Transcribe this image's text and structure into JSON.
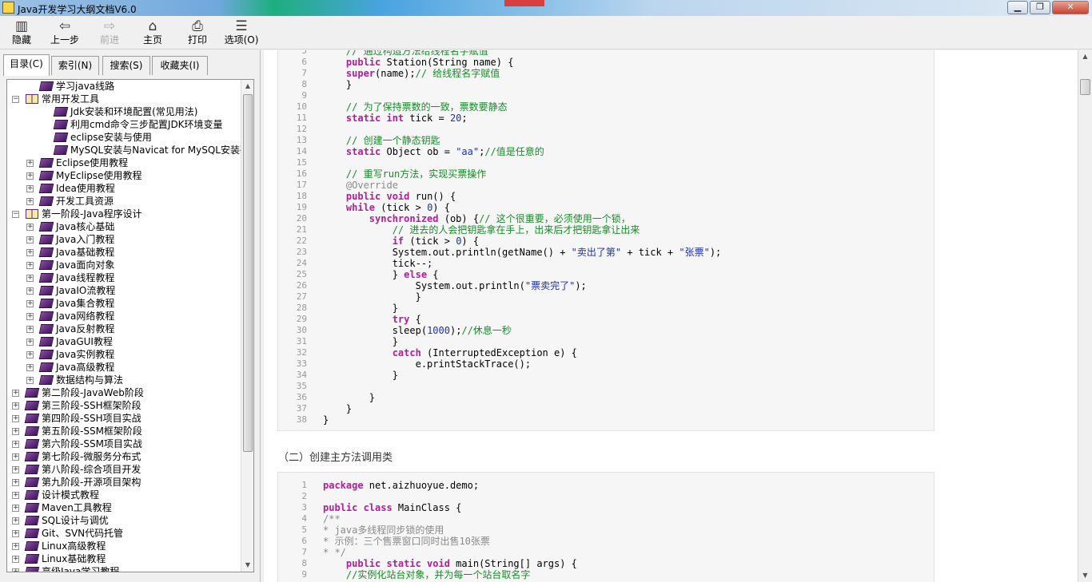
{
  "window": {
    "title": "Java开发学习大纲文档V6.0",
    "buttons": {
      "minimize": "▁",
      "restore": "❐",
      "close": "✕"
    }
  },
  "toolbar": {
    "hide": {
      "label": "隐藏",
      "icon": "hide-icon"
    },
    "back": {
      "label": "上一步",
      "icon": "back-arrow-icon"
    },
    "forward": {
      "label": "前进",
      "icon": "forward-arrow-icon"
    },
    "home": {
      "label": "主页",
      "icon": "home-icon"
    },
    "print": {
      "label": "打印",
      "icon": "printer-icon"
    },
    "options": {
      "label": "选项(O)",
      "icon": "options-icon"
    }
  },
  "nav_tabs": [
    {
      "label": "目录(C)"
    },
    {
      "label": "索引(N)"
    },
    {
      "label": "搜索(S)"
    },
    {
      "label": "收藏夹(I)"
    }
  ],
  "tree": [
    {
      "label": "学习java线路",
      "level": 1,
      "toggle": "",
      "icon": "book-closed"
    },
    {
      "label": "常用开发工具",
      "level": 0,
      "toggle": "−",
      "icon": "book-open"
    },
    {
      "label": "Jdk安装和环境配置(常见用法)",
      "level": 2,
      "toggle": "",
      "icon": "book-closed"
    },
    {
      "label": "利用cmd命令三步配置JDK环境变量",
      "level": 2,
      "toggle": "",
      "icon": "book-closed"
    },
    {
      "label": "eclipse安装与使用",
      "level": 2,
      "toggle": "",
      "icon": "book-closed"
    },
    {
      "label": "MySQL安装与Navicat for MySQL安装破解",
      "level": 2,
      "toggle": "",
      "icon": "book-closed"
    },
    {
      "label": "Eclipse使用教程",
      "level": 1,
      "toggle": "+",
      "icon": "book-closed"
    },
    {
      "label": "MyEclipse使用教程",
      "level": 1,
      "toggle": "+",
      "icon": "book-closed"
    },
    {
      "label": "Idea使用教程",
      "level": 1,
      "toggle": "+",
      "icon": "book-closed"
    },
    {
      "label": "开发工具资源",
      "level": 1,
      "toggle": "+",
      "icon": "book-closed"
    },
    {
      "label": "第一阶段-Java程序设计",
      "level": 0,
      "toggle": "−",
      "icon": "book-open"
    },
    {
      "label": "Java核心基础",
      "level": 1,
      "toggle": "+",
      "icon": "book-closed"
    },
    {
      "label": "Java入门教程",
      "level": 1,
      "toggle": "+",
      "icon": "book-closed"
    },
    {
      "label": "Java基础教程",
      "level": 1,
      "toggle": "+",
      "icon": "book-closed"
    },
    {
      "label": "Java面向对象",
      "level": 1,
      "toggle": "+",
      "icon": "book-closed"
    },
    {
      "label": "Java线程教程",
      "level": 1,
      "toggle": "+",
      "icon": "book-closed"
    },
    {
      "label": "JavaIO流教程",
      "level": 1,
      "toggle": "+",
      "icon": "book-closed"
    },
    {
      "label": "Java集合教程",
      "level": 1,
      "toggle": "+",
      "icon": "book-closed"
    },
    {
      "label": "Java网络教程",
      "level": 1,
      "toggle": "+",
      "icon": "book-closed"
    },
    {
      "label": "Java反射教程",
      "level": 1,
      "toggle": "+",
      "icon": "book-closed"
    },
    {
      "label": "JavaGUI教程",
      "level": 1,
      "toggle": "+",
      "icon": "book-closed"
    },
    {
      "label": "Java实例教程",
      "level": 1,
      "toggle": "+",
      "icon": "book-closed"
    },
    {
      "label": "Java高级教程",
      "level": 1,
      "toggle": "+",
      "icon": "book-closed"
    },
    {
      "label": "数据结构与算法",
      "level": 1,
      "toggle": "+",
      "icon": "book-closed"
    },
    {
      "label": "第二阶段-JavaWeb阶段",
      "level": 0,
      "toggle": "+",
      "icon": "book-closed"
    },
    {
      "label": "第三阶段-SSH框架阶段",
      "level": 0,
      "toggle": "+",
      "icon": "book-closed"
    },
    {
      "label": "第四阶段-SSH项目实战",
      "level": 0,
      "toggle": "+",
      "icon": "book-closed"
    },
    {
      "label": "第五阶段-SSM框架阶段",
      "level": 0,
      "toggle": "+",
      "icon": "book-closed"
    },
    {
      "label": "第六阶段-SSM项目实战",
      "level": 0,
      "toggle": "+",
      "icon": "book-closed"
    },
    {
      "label": "第七阶段-微服务分布式",
      "level": 0,
      "toggle": "+",
      "icon": "book-closed"
    },
    {
      "label": "第八阶段-综合项目开发",
      "level": 0,
      "toggle": "+",
      "icon": "book-closed"
    },
    {
      "label": "第九阶段-开源项目架构",
      "level": 0,
      "toggle": "+",
      "icon": "book-closed"
    },
    {
      "label": "设计模式教程",
      "level": 0,
      "toggle": "+",
      "icon": "book-closed"
    },
    {
      "label": "Maven工具教程",
      "level": 0,
      "toggle": "+",
      "icon": "book-closed"
    },
    {
      "label": "SQL设计与调优",
      "level": 0,
      "toggle": "+",
      "icon": "book-closed"
    },
    {
      "label": "Git、SVN代码托管",
      "level": 0,
      "toggle": "+",
      "icon": "book-closed"
    },
    {
      "label": "Linux高级教程",
      "level": 0,
      "toggle": "+",
      "icon": "book-closed"
    },
    {
      "label": "Linux基础教程",
      "level": 0,
      "toggle": "+",
      "icon": "book-closed"
    },
    {
      "label": "高级Java学习教程",
      "level": 0,
      "toggle": "+",
      "icon": "book-closed"
    }
  ],
  "code_block_1": {
    "lines": [
      {
        "n": "5",
        "indent": 4,
        "parts": [
          [
            "com",
            "// 通过构造方法给线程名字赋值"
          ]
        ]
      },
      {
        "n": "6",
        "indent": 4,
        "parts": [
          [
            "kw",
            "public"
          ],
          [
            "",
            " Station(String name) {"
          ]
        ]
      },
      {
        "n": "7",
        "indent": 4,
        "parts": [
          [
            "kw",
            "super"
          ],
          [
            "",
            "(name);"
          ],
          [
            "com",
            "// 给线程名字赋值"
          ]
        ]
      },
      {
        "n": "8",
        "indent": 4,
        "parts": [
          [
            "",
            "}"
          ]
        ]
      },
      {
        "n": "9",
        "indent": 0,
        "parts": []
      },
      {
        "n": "10",
        "indent": 4,
        "parts": [
          [
            "com",
            "// 为了保持票数的一致，票数要静态"
          ]
        ]
      },
      {
        "n": "11",
        "indent": 4,
        "parts": [
          [
            "kw",
            "static int"
          ],
          [
            "",
            " tick = "
          ],
          [
            "num",
            "20"
          ],
          [
            "",
            ";"
          ]
        ]
      },
      {
        "n": "12",
        "indent": 0,
        "parts": []
      },
      {
        "n": "13",
        "indent": 4,
        "parts": [
          [
            "com",
            "// 创建一个静态钥匙"
          ]
        ]
      },
      {
        "n": "14",
        "indent": 4,
        "parts": [
          [
            "kw",
            "static"
          ],
          [
            "",
            " Object ob = "
          ],
          [
            "str",
            "\"aa\""
          ],
          [
            "",
            ";"
          ],
          [
            "com",
            "//值是任意的"
          ]
        ]
      },
      {
        "n": "15",
        "indent": 0,
        "parts": []
      },
      {
        "n": "16",
        "indent": 4,
        "parts": [
          [
            "com",
            "// 重写run方法，实现买票操作"
          ]
        ]
      },
      {
        "n": "17",
        "indent": 4,
        "parts": [
          [
            "ann",
            "@Override"
          ]
        ]
      },
      {
        "n": "18",
        "indent": 4,
        "parts": [
          [
            "kw",
            "public void"
          ],
          [
            "",
            " run() {"
          ]
        ]
      },
      {
        "n": "19",
        "indent": 4,
        "parts": [
          [
            "kw",
            "while"
          ],
          [
            "",
            " (tick > "
          ],
          [
            "num",
            "0"
          ],
          [
            "",
            ") {"
          ]
        ]
      },
      {
        "n": "20",
        "indent": 8,
        "parts": [
          [
            "kw",
            "synchronized"
          ],
          [
            "",
            " (ob) {"
          ],
          [
            "com",
            "// 这个很重要，必须使用一个锁，"
          ]
        ]
      },
      {
        "n": "21",
        "indent": 12,
        "parts": [
          [
            "com",
            "// 进去的人会把钥匙拿在手上，出来后才把钥匙拿让出来"
          ]
        ]
      },
      {
        "n": "22",
        "indent": 12,
        "parts": [
          [
            "kw",
            "if"
          ],
          [
            "",
            " (tick > "
          ],
          [
            "num",
            "0"
          ],
          [
            "",
            ") {"
          ]
        ]
      },
      {
        "n": "23",
        "indent": 12,
        "parts": [
          [
            "",
            "System.out.println(getName() + "
          ],
          [
            "str",
            "\"卖出了第\""
          ],
          [
            "",
            " + tick + "
          ],
          [
            "str",
            "\"张票\""
          ],
          [
            "",
            ");"
          ]
        ]
      },
      {
        "n": "24",
        "indent": 12,
        "parts": [
          [
            "",
            "tick--;"
          ]
        ]
      },
      {
        "n": "25",
        "indent": 12,
        "parts": [
          [
            "",
            "} "
          ],
          [
            "kw",
            "else"
          ],
          [
            "",
            " {"
          ]
        ]
      },
      {
        "n": "26",
        "indent": 16,
        "parts": [
          [
            "",
            "System.out.println("
          ],
          [
            "str",
            "\"票卖完了\""
          ],
          [
            "",
            ");"
          ]
        ]
      },
      {
        "n": "27",
        "indent": 16,
        "parts": [
          [
            "",
            "}"
          ]
        ]
      },
      {
        "n": "28",
        "indent": 12,
        "parts": [
          [
            "",
            "}"
          ]
        ]
      },
      {
        "n": "29",
        "indent": 12,
        "parts": [
          [
            "kw",
            "try"
          ],
          [
            "",
            " {"
          ]
        ]
      },
      {
        "n": "30",
        "indent": 12,
        "parts": [
          [
            "",
            "sleep("
          ],
          [
            "num",
            "1000"
          ],
          [
            "",
            ");"
          ],
          [
            "com",
            "//休息一秒"
          ]
        ]
      },
      {
        "n": "31",
        "indent": 12,
        "parts": [
          [
            "",
            "}"
          ]
        ]
      },
      {
        "n": "32",
        "indent": 12,
        "parts": [
          [
            "kw",
            "catch"
          ],
          [
            "",
            " (InterruptedException e) {"
          ]
        ]
      },
      {
        "n": "33",
        "indent": 16,
        "parts": [
          [
            "",
            "e.printStackTrace();"
          ]
        ]
      },
      {
        "n": "34",
        "indent": 12,
        "parts": [
          [
            "",
            "}"
          ]
        ]
      },
      {
        "n": "35",
        "indent": 0,
        "parts": []
      },
      {
        "n": "36",
        "indent": 8,
        "parts": [
          [
            "",
            "}"
          ]
        ]
      },
      {
        "n": "37",
        "indent": 4,
        "parts": [
          [
            "",
            "}"
          ]
        ]
      },
      {
        "n": "38",
        "indent": 0,
        "parts": [
          [
            "",
            "}"
          ]
        ]
      }
    ]
  },
  "section_heading": "（二）创建主方法调用类",
  "code_block_2": {
    "lines": [
      {
        "n": "1",
        "indent": 0,
        "parts": [
          [
            "kw",
            "package"
          ],
          [
            "",
            " net.aizhuoyue.demo;"
          ]
        ]
      },
      {
        "n": "2",
        "indent": 0,
        "parts": []
      },
      {
        "n": "3",
        "indent": 0,
        "parts": [
          [
            "kw",
            "public class"
          ],
          [
            "",
            " MainClass {"
          ]
        ]
      },
      {
        "n": "4",
        "indent": 0,
        "parts": [
          [
            "cmtg",
            "/**"
          ]
        ]
      },
      {
        "n": "5",
        "indent": 0,
        "parts": [
          [
            "cmtg",
            "* java多线程同步锁的使用"
          ]
        ]
      },
      {
        "n": "6",
        "indent": 0,
        "parts": [
          [
            "cmtg",
            "* 示例：三个售票窗口同时出售10张票"
          ]
        ]
      },
      {
        "n": "7",
        "indent": 0,
        "parts": [
          [
            "cmtg",
            "* */"
          ]
        ]
      },
      {
        "n": "8",
        "indent": 4,
        "parts": [
          [
            "kw",
            "public static void"
          ],
          [
            "",
            " main(String[] args) {"
          ]
        ]
      },
      {
        "n": "9",
        "indent": 4,
        "parts": [
          [
            "com",
            "//实例化站台对象，并为每一个站台取名字"
          ]
        ]
      }
    ]
  }
}
